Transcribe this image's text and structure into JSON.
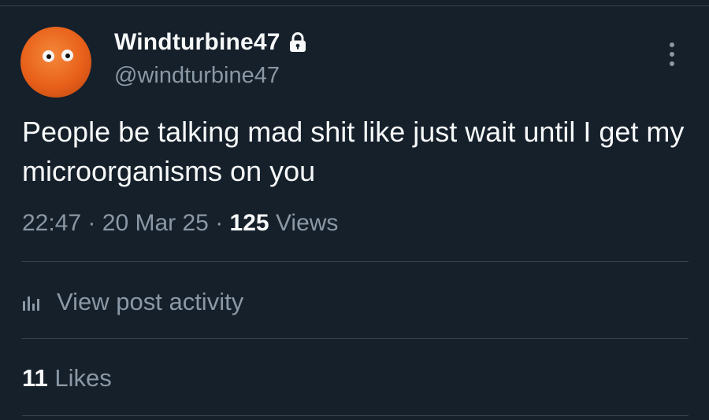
{
  "post": {
    "author": {
      "display_name": "Windturbine47",
      "handle": "@windturbine47",
      "protected_icon": "lock-icon",
      "avatar": "orange-with-googly-eyes"
    },
    "text": "People be talking mad shit like just wait until I get my microorganisms on you",
    "meta": {
      "time": "22:47",
      "date": "20 Mar 25",
      "separator": "·",
      "views_count": "125",
      "views_label": "Views"
    },
    "activity_label": "View post activity",
    "likes_count": "11",
    "likes_label": "Likes"
  },
  "colors": {
    "background": "#15202b",
    "primary_text": "#f7f9f9",
    "secondary_text": "#8b98a5",
    "divider": "#38444d"
  }
}
